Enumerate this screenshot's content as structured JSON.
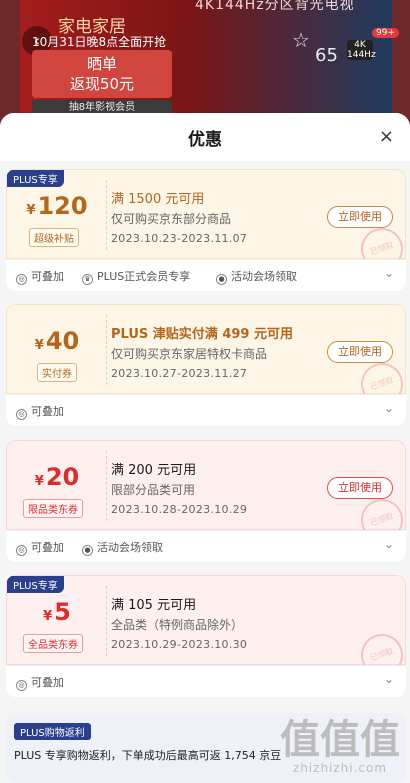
{
  "background": {
    "top_text": "4K144Hz分区背光电视",
    "banner_title": "家电家居",
    "banner_sub": "10月31日晚8点全面开抢",
    "banner_card_line1": "晒单",
    "banner_card_line2": "返现50元",
    "banner_member": "抽8年影视会员",
    "badge": "99+",
    "size_label": "65",
    "res_label": "4K",
    "hz_label": "144Hz"
  },
  "sheet": {
    "title": "优惠",
    "close": "×"
  },
  "coupons": [
    {
      "plus_tag": "PLUS专享",
      "currency": "¥",
      "amount": "120",
      "amount_tag": "超级补贴",
      "condition": "满 1500 元可用",
      "scope": "仅可购买京东部分商品",
      "dates": "2023.10.23-2023.11.07",
      "button": "立即使用",
      "stamp": "已领取",
      "features": [
        "可叠加",
        "PLUS正式会员专享",
        "活动会场领取"
      ]
    },
    {
      "currency": "¥",
      "amount": "40",
      "amount_tag": "实付券",
      "condition": "PLUS 津贴实付满 499 元可用",
      "scope": "仅可购买京东家居特权卡商品",
      "dates": "2023.10.27-2023.11.27",
      "button": "立即使用",
      "stamp": "已领取",
      "features": [
        "可叠加"
      ]
    },
    {
      "currency": "¥",
      "amount": "20",
      "amount_tag": "限品类东券",
      "condition": "满 200 元可用",
      "scope": "限部分品类可用",
      "dates": "2023.10.28-2023.10.29",
      "button": "立即使用",
      "stamp": "已领取",
      "features": [
        "可叠加",
        "活动会场领取"
      ]
    },
    {
      "plus_tag": "PLUS专享",
      "currency": "¥",
      "amount": "5",
      "amount_tag": "全品类东券",
      "condition": "满 105 元可用",
      "scope": "全品类（特例商品除外）",
      "dates": "2023.10.29-2023.10.30",
      "stamp": "已领取",
      "features": [
        "可叠加"
      ]
    }
  ],
  "return_card": {
    "tag": "PLUS购物返利",
    "text": "PLUS 专享购物返利，下单成功后最高可返 1,754 京豆"
  },
  "watermark": {
    "big": "值值值",
    "small": "zhizhizhi.com"
  }
}
